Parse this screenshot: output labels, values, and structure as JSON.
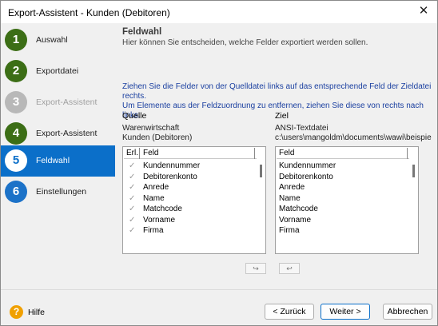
{
  "window": {
    "title": "Export-Assistent - Kunden (Debitoren)"
  },
  "steps": [
    {
      "number": "1",
      "label": "Auswahl"
    },
    {
      "number": "2",
      "label": "Exportdatei"
    },
    {
      "number": "3",
      "label": "Export-Assistent"
    },
    {
      "number": "4",
      "label": "Export-Assistent"
    },
    {
      "number": "5",
      "label": "Feldwahl"
    },
    {
      "number": "6",
      "label": "Einstellungen"
    }
  ],
  "header": {
    "title": "Feldwahl",
    "subtitle": "Hier können Sie entscheiden, welche Felder exportiert werden sollen."
  },
  "hint": {
    "line1": "Ziehen Sie die Felder von der Quelldatei links auf das entsprechende Feld der Zieldatei rechts.",
    "line2": "Um Elemente aus der Feldzuordnung zu entfernen, ziehen Sie diese von rechts nach links."
  },
  "source": {
    "title": "Quelle",
    "name": "Warenwirtschaft",
    "detail": "Kunden (Debitoren)",
    "columns": {
      "erl": "Erl.",
      "feld": "Feld"
    },
    "fields": [
      "Kundennummer",
      "Debitorenkonto",
      "Anrede",
      "Name",
      "Matchcode",
      "Vorname",
      "Firma"
    ]
  },
  "target": {
    "title": "Ziel",
    "name": "ANSI-Textdatei",
    "detail": "c:\\users\\mangoldm\\documents\\wawi\\beispie",
    "columns": {
      "feld": "Feld"
    },
    "fields": [
      "Kundennummer",
      "Debitorenkonto",
      "Anrede",
      "Name",
      "Matchcode",
      "Vorname",
      "Firma"
    ]
  },
  "footer": {
    "help": "Hilfe",
    "back": "< Zurück",
    "next": "Weiter >",
    "cancel": "Abbrechen"
  }
}
